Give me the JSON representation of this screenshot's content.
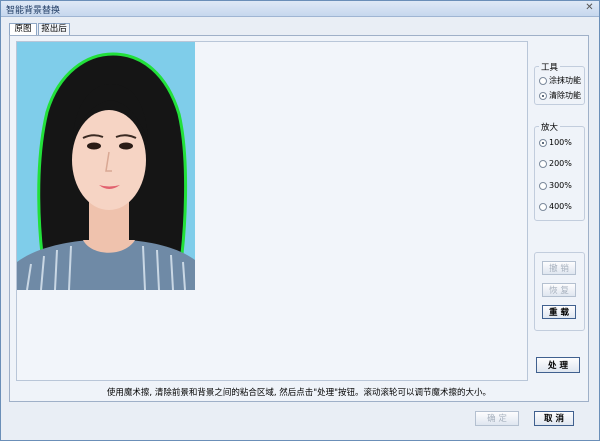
{
  "window": {
    "title": "智能背景替换",
    "close_glyph": "✕"
  },
  "tabs": [
    {
      "label": "原图"
    },
    {
      "label": "抠出后"
    }
  ],
  "tools": {
    "legend": "工具",
    "options": [
      {
        "label": "涂抹功能",
        "selected": false
      },
      {
        "label": "清除功能",
        "selected": true
      }
    ]
  },
  "zoom": {
    "legend": "放大",
    "options": [
      {
        "label": "100%",
        "selected": true
      },
      {
        "label": "200%",
        "selected": false
      },
      {
        "label": "300%",
        "selected": false
      },
      {
        "label": "400%",
        "selected": false
      }
    ]
  },
  "actions": {
    "undo": "撤 销",
    "redo": "恢 复",
    "reset": "重 载",
    "process": "处 理"
  },
  "hint": "使用魔术擦, 清除前景和背景之间的粘合区域, 然后点击\"处理\"按钮。滚动滚轮可以调节魔术擦的大小。",
  "footer": {
    "ok": "确 定",
    "cancel": "取 消"
  },
  "colors": {
    "photo_bg": "#7fcdea",
    "edge_highlight": "#22e03a"
  }
}
